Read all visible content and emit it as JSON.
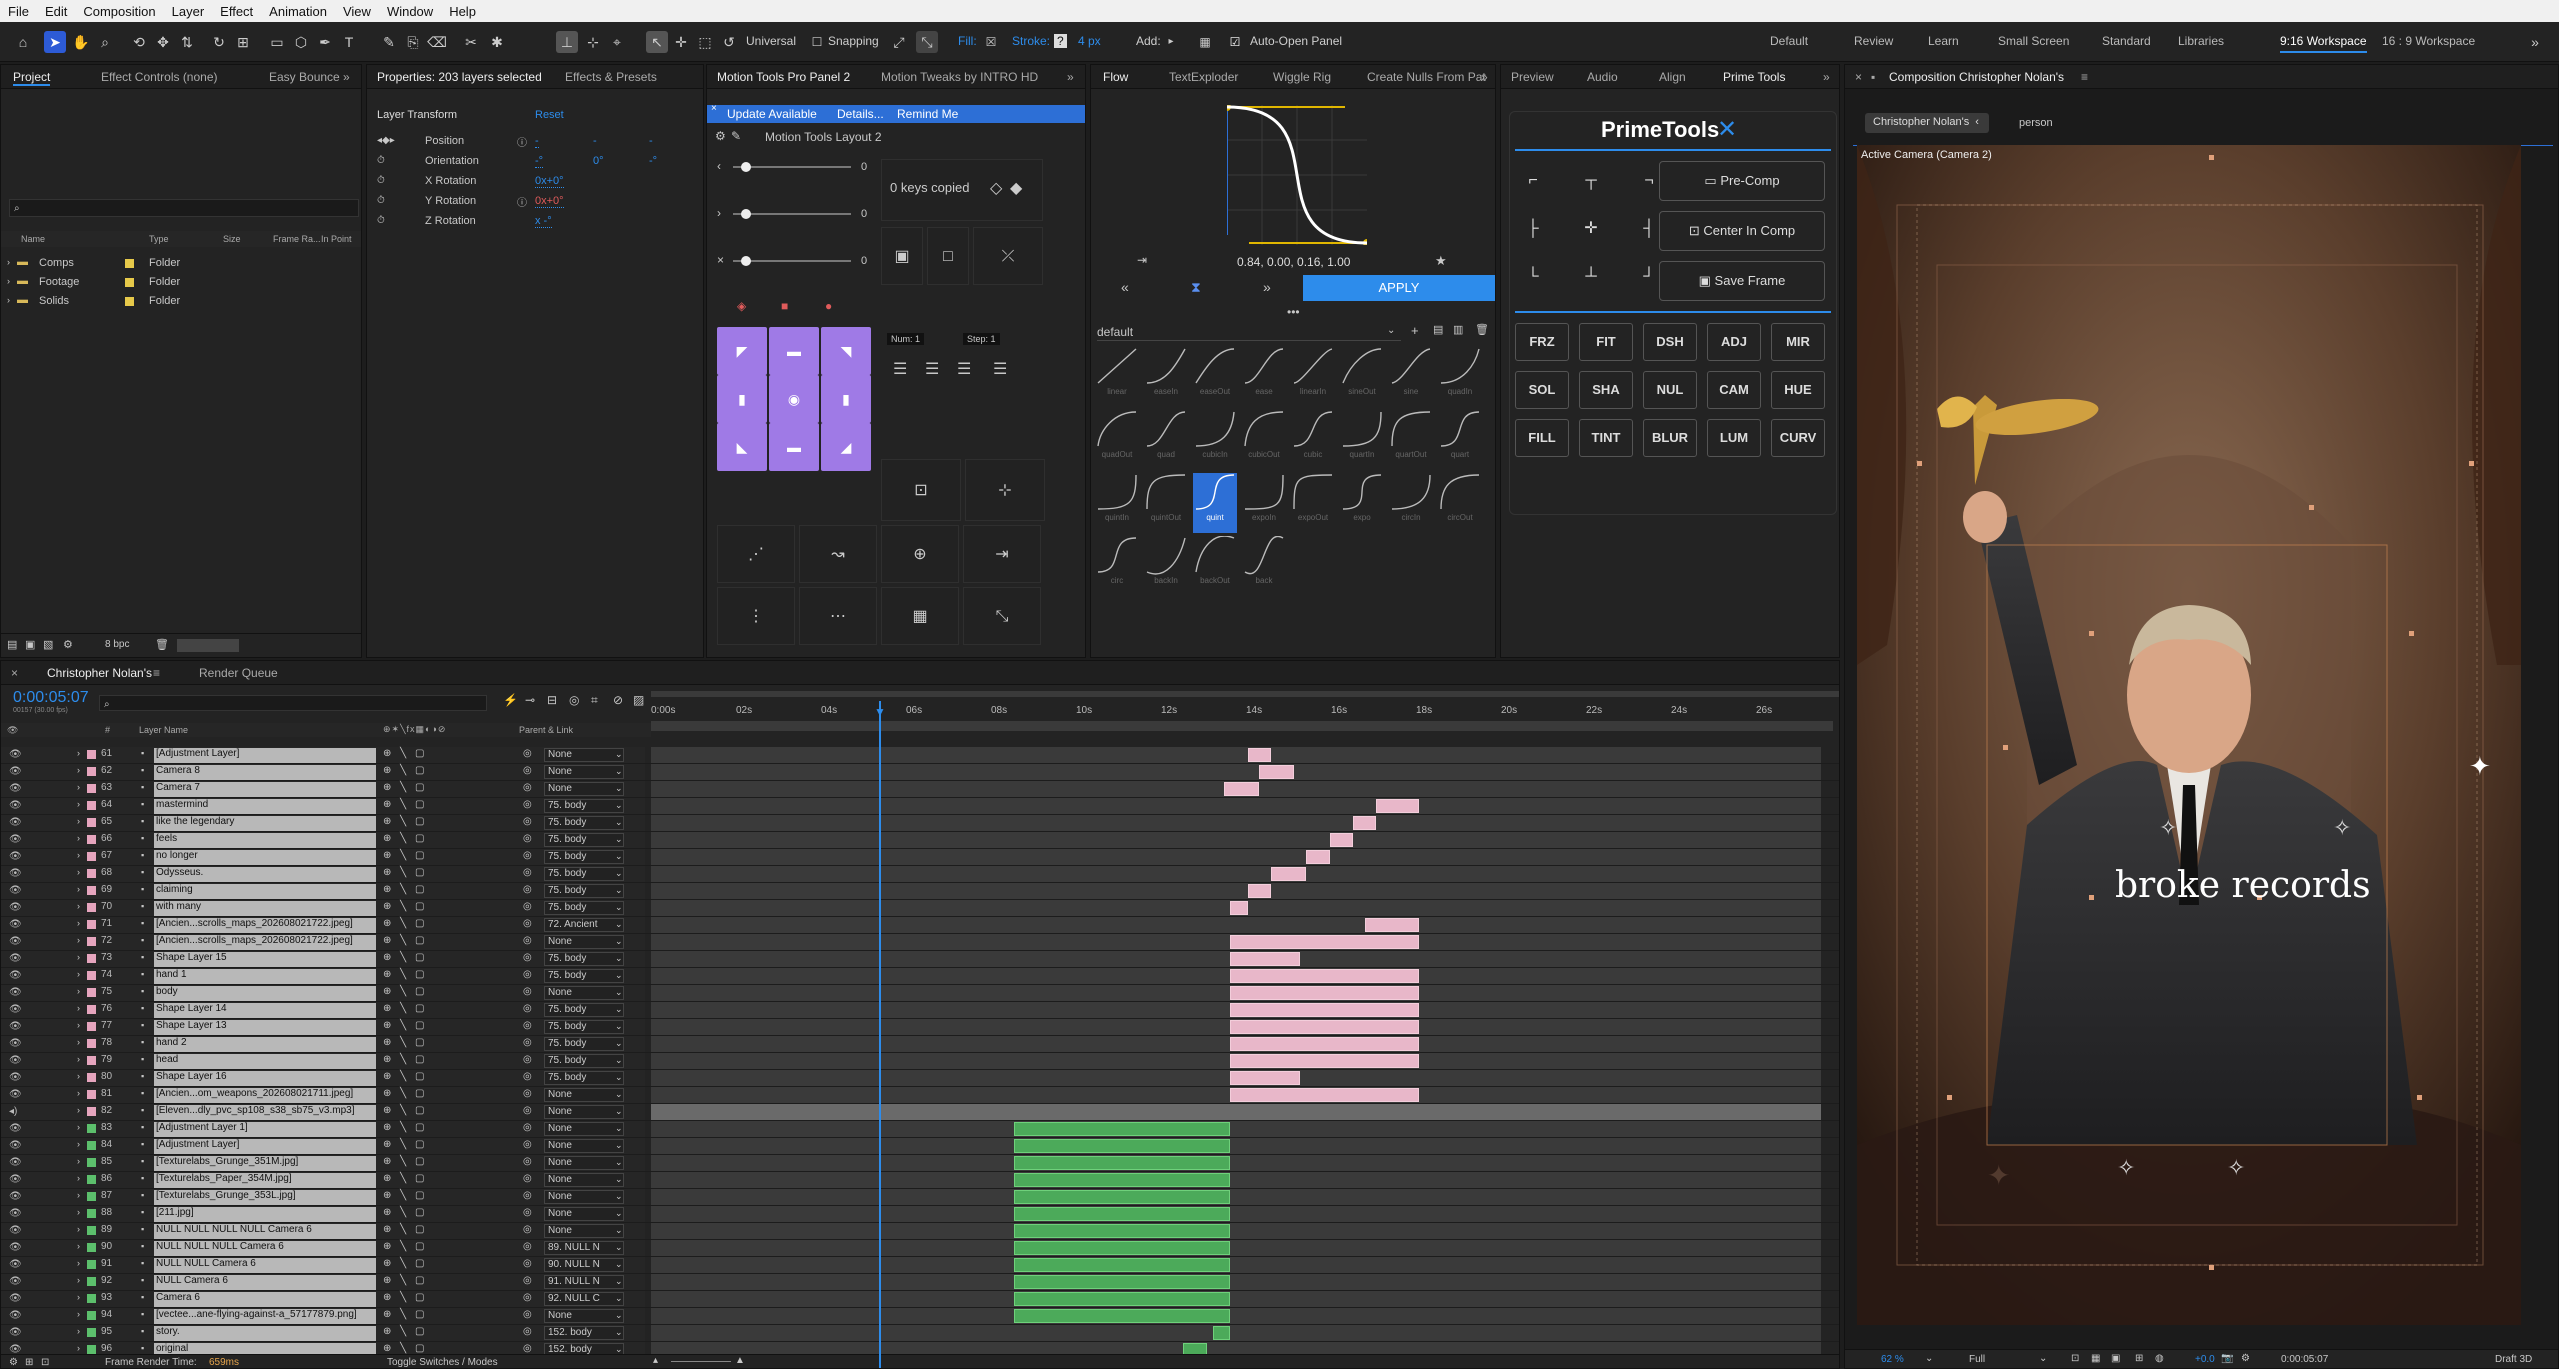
{
  "menu": [
    "File",
    "Edit",
    "Composition",
    "Layer",
    "Effect",
    "Animation",
    "View",
    "Window",
    "Help"
  ],
  "toolbar": {
    "universal": "Universal",
    "snapping": "Snapping",
    "fill": "Fill:",
    "stroke": "Stroke:",
    "stroke_q": "?",
    "stroke_px": "4 px",
    "add": "Add:",
    "auto_open": "Auto-Open Panel",
    "workspaces": [
      "Default",
      "Review",
      "Learn",
      "Small Screen",
      "Standard",
      "Libraries",
      "9:16 Workspace",
      "16 : 9 Workspace"
    ],
    "active_ws": "9:16 Workspace"
  },
  "project": {
    "tabs": [
      "Project",
      "Effect Controls (none)",
      "Easy Bounce"
    ],
    "columns": [
      "Name",
      "Type",
      "Size",
      "Frame Ra...",
      "In Point"
    ],
    "items": [
      {
        "name": "Comps",
        "type": "Folder"
      },
      {
        "name": "Footage",
        "type": "Folder"
      },
      {
        "name": "Solids",
        "type": "Folder"
      }
    ],
    "bpc": "8 bpc"
  },
  "properties": {
    "tabs": [
      "Properties: 203 layers selected",
      "Effects & Presets"
    ],
    "section": "Layer Transform",
    "reset": "Reset",
    "props": [
      {
        "label": "Position",
        "value": "-",
        "value2": "-",
        "value3": "-"
      },
      {
        "label": "Orientation",
        "value": "-°",
        "value2": "0°",
        "value3": "-°"
      },
      {
        "label": "X Rotation",
        "value": "0x+0°"
      },
      {
        "label": "Y Rotation",
        "value": "0x+0°"
      },
      {
        "label": "Z Rotation",
        "value": "x -°"
      }
    ]
  },
  "motion_tools": {
    "tabs": [
      "Motion Tools Pro Panel 2",
      "Motion Tweaks by INTRO HD"
    ],
    "update": "Update Available",
    "details": "Details...",
    "remind": "Remind Me",
    "layout": "Motion Tools Layout 2",
    "slider_values": [
      "0",
      "0",
      "0"
    ],
    "keys_copied": "0 keys copied",
    "num": "Num: 1",
    "step": "Step: 1"
  },
  "flow": {
    "tabs": [
      "Flow",
      "TextExploder",
      "Wiggle Rig",
      "Create Nulls From Pat"
    ],
    "values": "0.84, 0.00, 0.16, 1.00",
    "apply": "APPLY",
    "preset": "default",
    "curves": [
      {
        "name": "linear"
      },
      {
        "name": "easeIn"
      },
      {
        "name": "easeOut"
      },
      {
        "name": "ease"
      },
      {
        "name": "linearIn"
      },
      {
        "name": "sineOut"
      },
      {
        "name": "sine"
      },
      {
        "name": "quadIn"
      },
      {
        "name": "quadOut"
      },
      {
        "name": "quad"
      },
      {
        "name": "cubicIn"
      },
      {
        "name": "cubicOut"
      },
      {
        "name": "cubic"
      },
      {
        "name": "quartIn"
      },
      {
        "name": "quartOut"
      },
      {
        "name": "quart"
      },
      {
        "name": "quintIn"
      },
      {
        "name": "quintOut"
      },
      {
        "name": "quint"
      },
      {
        "name": "expoIn"
      },
      {
        "name": "expoOut"
      },
      {
        "name": "expo"
      },
      {
        "name": "circIn"
      },
      {
        "name": "circOut"
      },
      {
        "name": "circ"
      },
      {
        "name": "backIn"
      },
      {
        "name": "backOut"
      },
      {
        "name": "back"
      }
    ],
    "selected": "quint"
  },
  "prime": {
    "tabs": [
      "Preview",
      "Audio",
      "Align",
      "Prime Tools"
    ],
    "title": "PrimeTools",
    "buttons": [
      "Pre-Comp",
      "Center In Comp",
      "Save Frame"
    ],
    "grid": [
      "FRZ",
      "FIT",
      "DSH",
      "ADJ",
      "MIR",
      "SOL",
      "SHA",
      "NUL",
      "CAM",
      "HUE",
      "FILL",
      "TINT",
      "BLUR",
      "LUM",
      "CURV"
    ]
  },
  "composition": {
    "tab": "Composition Christopher Nolan's",
    "crumb": "Christopher Nolan's",
    "crumb2": "person",
    "camera": "Active Camera (Camera 2)",
    "overlay_text": "broke records",
    "zoom": "62 %",
    "quality": "Full",
    "time": "0:00:05:07",
    "exposure": "+0.0",
    "renderer": "Draft 3D"
  },
  "timeline": {
    "tab": "Christopher Nolan's",
    "render_queue": "Render Queue",
    "timecode": "0:00:05:07",
    "subtime": "00157 (30.00 fps)",
    "layer_col": "Layer Name",
    "parent_col": "Parent & Link",
    "ruler": [
      "0:00s",
      "02s",
      "04s",
      "06s",
      "08s",
      "10s",
      "12s",
      "14s",
      "16s",
      "18s",
      "20s",
      "22s",
      "24s",
      "26s"
    ],
    "footer_left": "Frame Render Time:",
    "footer_ms": "659ms",
    "footer_toggle": "Toggle Switches / Modes",
    "layers": [
      {
        "n": "61",
        "name": "[Adjustment Layer]",
        "parent": "None",
        "c": "#e6a5be",
        "bar": [
          0.51,
          0.53,
          "pink"
        ]
      },
      {
        "n": "62",
        "name": "Camera 8",
        "parent": "None",
        "c": "#e6a5be",
        "bar": [
          0.52,
          0.55,
          "pink"
        ]
      },
      {
        "n": "63",
        "name": "Camera 7",
        "parent": "None",
        "c": "#e6a5be",
        "bar": [
          0.49,
          0.52,
          "pink"
        ]
      },
      {
        "n": "64",
        "name": "mastermind",
        "parent": "75. body",
        "c": "#e6a5be",
        "bar": [
          0.62,
          0.656,
          "pink"
        ]
      },
      {
        "n": "65",
        "name": "like the legendary",
        "parent": "75. body",
        "c": "#e6a5be",
        "bar": [
          0.6,
          0.62,
          "pink"
        ]
      },
      {
        "n": "66",
        "name": "feels",
        "parent": "75. body",
        "c": "#e6a5be",
        "bar": [
          0.58,
          0.6,
          "pink"
        ]
      },
      {
        "n": "67",
        "name": "no longer",
        "parent": "75. body",
        "c": "#e6a5be",
        "bar": [
          0.56,
          0.58,
          "pink"
        ]
      },
      {
        "n": "68",
        "name": "Odysseus.",
        "parent": "75. body",
        "c": "#e6a5be",
        "bar": [
          0.53,
          0.56,
          "pink"
        ]
      },
      {
        "n": "69",
        "name": "claiming",
        "parent": "75. body",
        "c": "#e6a5be",
        "bar": [
          0.51,
          0.53,
          "pink"
        ]
      },
      {
        "n": "70",
        "name": "with many",
        "parent": "75. body",
        "c": "#e6a5be",
        "bar": [
          0.495,
          0.51,
          "pink"
        ]
      },
      {
        "n": "71",
        "name": "[Ancien...scrolls_maps_202608021722.jpeg]",
        "parent": "72. Ancient",
        "c": "#e6a5be",
        "bar": [
          0.61,
          0.656,
          "pink"
        ]
      },
      {
        "n": "72",
        "name": "[Ancien...scrolls_maps_202608021722.jpeg]",
        "parent": "None",
        "c": "#e6a5be",
        "bar": [
          0.495,
          0.656,
          "pink"
        ]
      },
      {
        "n": "73",
        "name": "Shape Layer 15",
        "parent": "75. body",
        "c": "#e6a5be",
        "bar": [
          0.495,
          0.555,
          "pink"
        ]
      },
      {
        "n": "74",
        "name": "hand 1",
        "parent": "75. body",
        "c": "#e6a5be",
        "bar": [
          0.495,
          0.656,
          "pink"
        ]
      },
      {
        "n": "75",
        "name": "body",
        "parent": "None",
        "c": "#e6a5be",
        "bar": [
          0.495,
          0.656,
          "pink"
        ]
      },
      {
        "n": "76",
        "name": "Shape Layer 14",
        "parent": "75. body",
        "c": "#e6a5be",
        "bar": [
          0.495,
          0.656,
          "pink"
        ]
      },
      {
        "n": "77",
        "name": "Shape Layer 13",
        "parent": "75. body",
        "c": "#e6a5be",
        "bar": [
          0.495,
          0.656,
          "pink"
        ]
      },
      {
        "n": "78",
        "name": "hand 2",
        "parent": "75. body",
        "c": "#e6a5be",
        "bar": [
          0.495,
          0.656,
          "pink"
        ]
      },
      {
        "n": "79",
        "name": "head",
        "parent": "75. body",
        "c": "#e6a5be",
        "bar": [
          0.495,
          0.656,
          "pink"
        ]
      },
      {
        "n": "80",
        "name": "Shape Layer 16",
        "parent": "75. body",
        "c": "#e6a5be",
        "bar": [
          0.495,
          0.555,
          "pink"
        ]
      },
      {
        "n": "81",
        "name": "[Ancien...om_weapons_202608021711.jpeg]",
        "parent": "None",
        "c": "#e6a5be",
        "bar": [
          0.495,
          0.656,
          "pink"
        ]
      },
      {
        "n": "82",
        "name": "[Eleven...dly_pvc_sp108_s38_sb75_v3.mp3]",
        "parent": "None",
        "c": "#e6a5be",
        "bar": [
          0,
          1,
          "audio"
        ]
      },
      {
        "n": "83",
        "name": "[Adjustment Layer 1]",
        "parent": "None",
        "c": "#5cbf6c",
        "bar": [
          0.31,
          0.495,
          "green"
        ]
      },
      {
        "n": "84",
        "name": "[Adjustment Layer]",
        "parent": "None",
        "c": "#5cbf6c",
        "bar": [
          0.31,
          0.495,
          "green"
        ]
      },
      {
        "n": "85",
        "name": "[Texturelabs_Grunge_351M.jpg]",
        "parent": "None",
        "c": "#5cbf6c",
        "bar": [
          0.31,
          0.495,
          "green"
        ]
      },
      {
        "n": "86",
        "name": "[Texturelabs_Paper_354M.jpg]",
        "parent": "None",
        "c": "#5cbf6c",
        "bar": [
          0.31,
          0.495,
          "green"
        ]
      },
      {
        "n": "87",
        "name": "[Texturelabs_Grunge_353L.jpg]",
        "parent": "None",
        "c": "#5cbf6c",
        "bar": [
          0.31,
          0.495,
          "green"
        ]
      },
      {
        "n": "88",
        "name": "[211.jpg]",
        "parent": "None",
        "c": "#5cbf6c",
        "bar": [
          0.31,
          0.495,
          "green"
        ]
      },
      {
        "n": "89",
        "name": "NULL NULL NULL NULL Camera 6",
        "parent": "None",
        "c": "#5cbf6c",
        "bar": [
          0.31,
          0.495,
          "green"
        ]
      },
      {
        "n": "90",
        "name": "NULL NULL NULL Camera 6",
        "parent": "89. NULL N",
        "c": "#5cbf6c",
        "bar": [
          0.31,
          0.495,
          "green"
        ]
      },
      {
        "n": "91",
        "name": "NULL NULL Camera 6",
        "parent": "90. NULL N",
        "c": "#5cbf6c",
        "bar": [
          0.31,
          0.495,
          "green"
        ]
      },
      {
        "n": "92",
        "name": "NULL Camera 6",
        "parent": "91. NULL N",
        "c": "#5cbf6c",
        "bar": [
          0.31,
          0.495,
          "green"
        ]
      },
      {
        "n": "93",
        "name": "Camera 6",
        "parent": "92. NULL C",
        "c": "#5cbf6c",
        "bar": [
          0.31,
          0.495,
          "green"
        ]
      },
      {
        "n": "94",
        "name": "[vectee...ane-flying-against-a_57177879.png]",
        "parent": "None",
        "c": "#5cbf6c",
        "bar": [
          0.31,
          0.495,
          "green"
        ]
      },
      {
        "n": "95",
        "name": "story.",
        "parent": "152. body",
        "c": "#5cbf6c",
        "bar": [
          0.48,
          0.495,
          "green"
        ]
      },
      {
        "n": "96",
        "name": "original",
        "parent": "152. body",
        "c": "#5cbf6c",
        "bar": [
          0.455,
          0.475,
          "green"
        ]
      }
    ]
  }
}
